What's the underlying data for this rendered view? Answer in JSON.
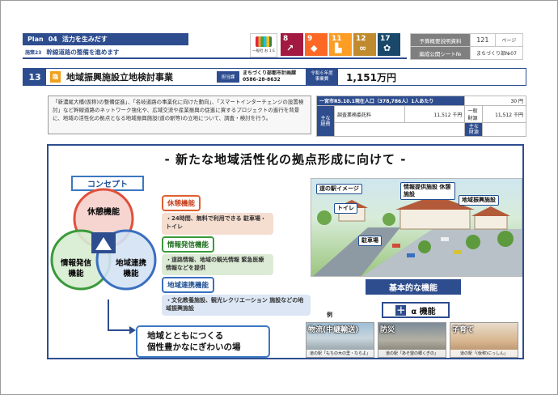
{
  "header": {
    "plan_label": "Plan",
    "plan_number": "04",
    "plan_title": "活力を生みだす",
    "policy_tag": "施策23",
    "policy_title": "幹線道路の整備を進めます",
    "sdgs_logo_caption": "一般社  お 1 E",
    "sdg_icons": [
      {
        "number": "8",
        "color": "#a21942"
      },
      {
        "number": "9",
        "color": "#fd6925"
      },
      {
        "number": "11",
        "color": "#fd9d24"
      },
      {
        "number": "12",
        "color": "#bf8b2e"
      },
      {
        "number": "17",
        "color": "#19486a"
      }
    ],
    "ref": {
      "doc_label": "予算概要説明資料",
      "page": "121",
      "page_unit": "ページ",
      "sheet_label": "編成公開シート№",
      "sheet_value": "まちづくり部№07"
    }
  },
  "project": {
    "number": "13",
    "badge": "臨",
    "title": "地域振興施設立地検討事業",
    "contact_label": "担当課",
    "department": "まちづくり部都市計画課",
    "phone": "0586-28-8632",
    "budget_label_line1": "令和６年度",
    "budget_label_line2": "事業費",
    "budget": "1,151万円",
    "summary": "「新濃尾大橋(仮称)の整備促進」、「名岐道路の事業化に向けた動向」、「スマートインターチェンジの設置検討」など幹線道路のネットワーク強化や、広域交流や産業振興の促進に資するプロジェクトの進行を背景に、地域の活性化の拠点となる地域振興施設(道の駅等)の立地について、調査・検討を行う。"
  },
  "cost": {
    "population_row": "一宮市R5.10.1現在人口（378,786人）1人あたり",
    "per_person": "30 円",
    "side1": "主な経費",
    "item1_label": "調査業務委託料",
    "item1_value": "11,512 千円",
    "side2": "主な財源",
    "item2_label": "一般財源",
    "item2_value": "11,512 千円"
  },
  "main": {
    "title": "- 新たな地域活性化の拠点形成に向けて -",
    "concept_label": "コンセプト",
    "venn": {
      "rest": "休憩機能",
      "info_line1": "情報発信",
      "info_line2": "機能",
      "link_line1": "地域連携",
      "link_line2": "機能"
    },
    "functions": {
      "rest_title": "休憩機能",
      "rest_desc": "・24時間、無料で利用できる 駐車場・トイレ",
      "info_title": "情報発信機能",
      "info_desc": "・道路情報、地域の観光情報 緊急医療情報などを提供",
      "link_title": "地域連携機能",
      "link_desc": "・文化教養施設、観光レクリエーション 施設などの地域振興施設"
    },
    "slogan_line1": "地域とともにつくる",
    "slogan_line2": "個性豊かなにぎわいの場",
    "scene": {
      "title": "道の駅イメージ",
      "toilet": "トイレ",
      "info": "情報提供施設 休憩施設",
      "promo": "地域振興施設",
      "parking": "駐車場"
    },
    "basic_label": "基本的な機能",
    "plus_label": "α 機能",
    "plus_symbol": "＋",
    "example_label": "例",
    "examples": [
      {
        "title": "物流(中継輸送)",
        "caption": "道の駅「もちの木の里・ならよ」"
      },
      {
        "title": "防災",
        "caption": "道の駅「あそ望の郷くぎの」"
      },
      {
        "title": "子育て",
        "caption": "道の駅「(仮称)にっしん」"
      }
    ]
  }
}
